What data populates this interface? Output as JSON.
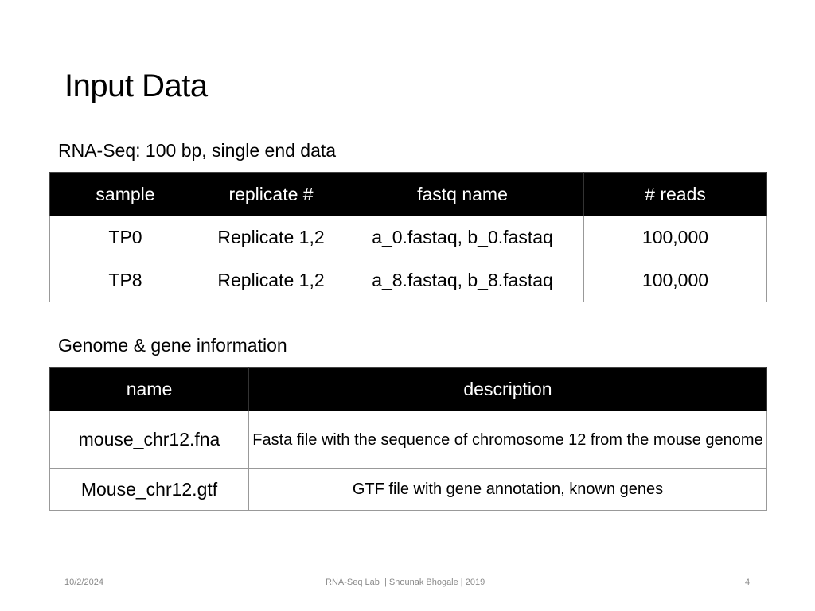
{
  "slide": {
    "title": "Input Data",
    "sections": [
      {
        "heading": "RNA-Seq: 100 bp, single end data",
        "columns": [
          "sample",
          "replicate #",
          "fastq name",
          "# reads"
        ],
        "rows": [
          [
            "TP0",
            "Replicate 1,2",
            "a_0.fastaq, b_0.fastaq",
            "100,000"
          ],
          [
            "TP8",
            "Replicate 1,2",
            "a_8.fastaq, b_8.fastaq",
            "100,000"
          ]
        ]
      },
      {
        "heading": "Genome & gene information",
        "columns": [
          "name",
          "description"
        ],
        "rows": [
          [
            "mouse_chr12.fna",
            "Fasta file with the sequence of chromosome 12 from the mouse genome"
          ],
          [
            "Mouse_chr12.gtf",
            "GTF file with gene annotation, known genes"
          ]
        ]
      }
    ],
    "footer": {
      "date": "10/2/2024",
      "center": "RNA-Seq Lab  | Shounak Bhogale | 2019",
      "page_number": "4"
    }
  }
}
